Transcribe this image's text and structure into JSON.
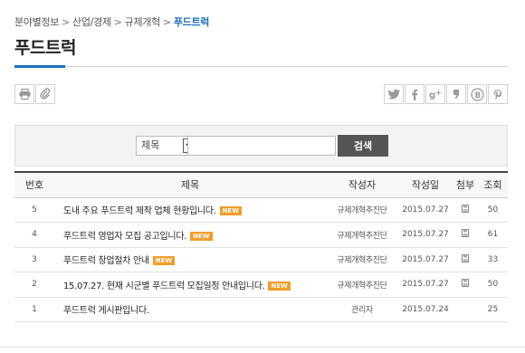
{
  "breadcrumb": {
    "items": [
      "분야별정보",
      "산업/경제",
      "규제개혁"
    ],
    "current": "푸드트럭",
    "separator": ">"
  },
  "page": {
    "title": "푸드트럭",
    "accent_color": "#1a6fc0"
  },
  "tools": {
    "print_icon": "print-icon",
    "attach_icon": "paperclip-icon"
  },
  "share": {
    "icons": [
      "twitter-icon",
      "facebook-icon",
      "google-plus-icon",
      "quote-icon",
      "blog-icon",
      "pinterest-icon"
    ]
  },
  "search": {
    "select_value": "제목",
    "input_value": "",
    "button_label": "검색"
  },
  "table": {
    "headers": [
      "번호",
      "제목",
      "작성자",
      "작성일",
      "첨부",
      "조회"
    ],
    "rows": [
      {
        "no": "5",
        "title": "도내 주요 푸드트럭 제작 업체 현황입니다.",
        "new": "NEW",
        "writer": "규제개혁추진단",
        "date": "2015.07.27",
        "attach": true,
        "views": "50"
      },
      {
        "no": "4",
        "title": "푸드트럭 영업자 모집 공고입니다.",
        "new": "NEW",
        "writer": "규제개혁추진단",
        "date": "2015.07.27",
        "attach": true,
        "views": "61"
      },
      {
        "no": "3",
        "title": "푸드트럭 창업절차 안내",
        "new": "NEW",
        "writer": "규제개혁추진단",
        "date": "2015.07.27",
        "attach": true,
        "views": "33"
      },
      {
        "no": "2",
        "title": "15.07.27. 현재 시군별 푸드트럭 모집일정 안내입니다.",
        "new": "NEW",
        "writer": "규제개혁추진단",
        "date": "2015.07.27",
        "attach": true,
        "views": "50"
      },
      {
        "no": "1",
        "title": "푸드트럭 게시판입니다.",
        "new": "",
        "writer": "관리자",
        "date": "2015.07.24",
        "attach": false,
        "views": "25"
      }
    ],
    "badge_color": "#f39c2a"
  }
}
